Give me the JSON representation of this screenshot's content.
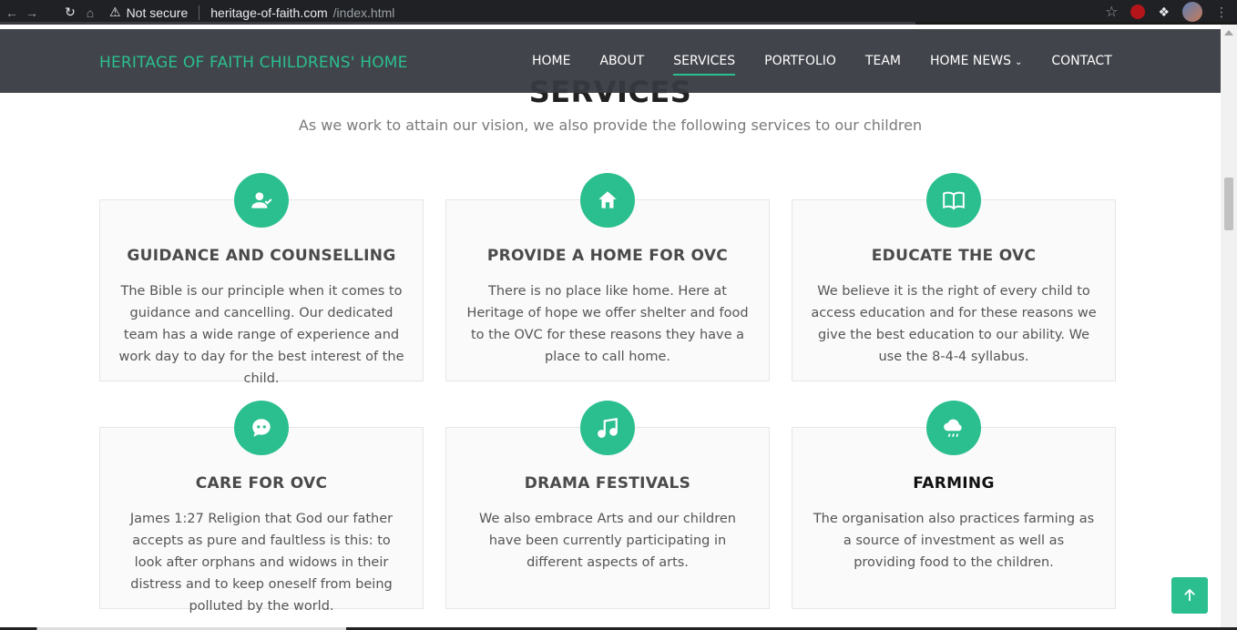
{
  "browser": {
    "security_label": "Not secure",
    "url_host": "heritage-of-faith.com",
    "url_path": "/index.html"
  },
  "site": {
    "logo": "HERITAGE OF FAITH CHILDRENS' HOME",
    "nav": [
      {
        "label": "HOME"
      },
      {
        "label": "ABOUT"
      },
      {
        "label": "SERVICES"
      },
      {
        "label": "PORTFOLIO"
      },
      {
        "label": "TEAM"
      },
      {
        "label": "HOME NEWS"
      },
      {
        "label": "CONTACT"
      }
    ]
  },
  "section": {
    "title": "SERVICES",
    "subtitle": "As we work to attain our vision, we also provide the following services to our children"
  },
  "services": [
    {
      "title": "GUIDANCE AND COUNSELLING",
      "icon": "user-check-icon",
      "text": "The Bible is our principle when it comes to guidance and cancelling. Our dedicated team has a wide range of experience and work day to day for the best interest of the child."
    },
    {
      "title": "PROVIDE A HOME FOR OVC",
      "icon": "home-icon",
      "text": "There is no place like home. Here at Heritage of hope we offer shelter and food to the OVC for these reasons they have a place to call home."
    },
    {
      "title": "EDUCATE THE OVC",
      "icon": "book-icon",
      "text": "We believe it is the right of every child to access education and for these reasons we give the best education to our ability. We use the 8-4-4 syllabus."
    },
    {
      "title": "CARE FOR OVC",
      "icon": "chat-icon",
      "text": "James 1:27 Religion that God our father accepts as pure and faultless is this: to look after orphans and widows in their distress and to keep oneself from being polluted by the world."
    },
    {
      "title": "DRAMA FESTIVALS",
      "icon": "music-icon",
      "text": "We also embrace Arts and our children have been currently participating in different aspects of arts."
    },
    {
      "title": "FARMING",
      "icon": "cloud-rain-icon",
      "text": "The organisation also practices farming as a source of investment as well as providing food to the children."
    }
  ],
  "colors": {
    "accent": "#2bbf8f",
    "header_bg": "#373a40"
  }
}
